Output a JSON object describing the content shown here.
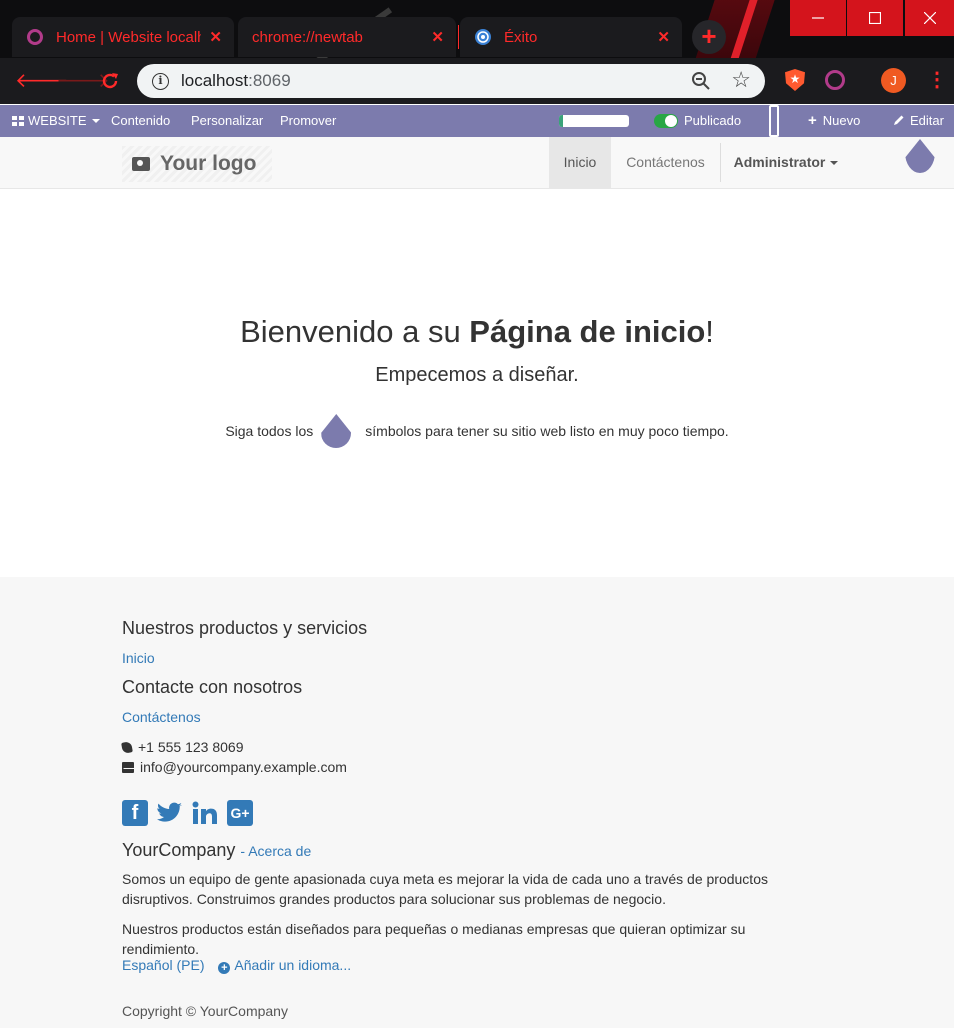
{
  "browser": {
    "tabs": [
      {
        "title": "Home | Website localhost",
        "favicon": "odoo-icon"
      },
      {
        "title": "chrome://newtab",
        "favicon": ""
      },
      {
        "title": "Éxito",
        "favicon": "exito-icon"
      }
    ],
    "url_host": "localhost",
    "url_port": ":8069",
    "profile_initial": "J",
    "accent_color": "#ff2a2a"
  },
  "adminbar": {
    "website_label": "WEBSITE",
    "contenido": "Contenido",
    "personalizar": "Personalizar",
    "promover": "Promover",
    "progress_fraction": 0.06,
    "publicado": "Publicado",
    "nuevo": "Nuevo",
    "editar": "Editar",
    "bar_color": "#7c7bad"
  },
  "header": {
    "logo_text": "Your logo",
    "menu": {
      "inicio": "Inicio",
      "contactenos": "Contáctenos",
      "admin": "Administrator"
    }
  },
  "hero": {
    "title_prefix": "Bienvenido a su ",
    "title_bold": "Página de inicio",
    "title_suffix": "!",
    "subtitle": "Empecemos a diseñar.",
    "tip_before": "Siga todos los",
    "tip_after": "símbolos para tener su sitio web listo en muy poco tiempo."
  },
  "footer": {
    "products_heading": "Nuestros productos y servicios",
    "products_link": "Inicio",
    "contact_heading": "Contacte con nosotros",
    "contact_link": "Contáctenos",
    "phone": "+1 555 123 8069",
    "email": "info@yourcompany.example.com",
    "company_name": "YourCompany",
    "about_link": "- Acerca de",
    "para1": "Somos un equipo de gente apasionada cuya meta es mejorar la vida de cada uno a través de productos disruptivos. Construimos grandes productos para solucionar sus problemas de negocio.",
    "para2": "Nuestros productos están diseñados para pequeñas o medianas empresas que quieran optimizar su rendimiento.",
    "language": "Español (PE)",
    "add_language": "Añadir un idioma...",
    "copyright": "Copyright © YourCompany",
    "link_color": "#337ab7"
  }
}
